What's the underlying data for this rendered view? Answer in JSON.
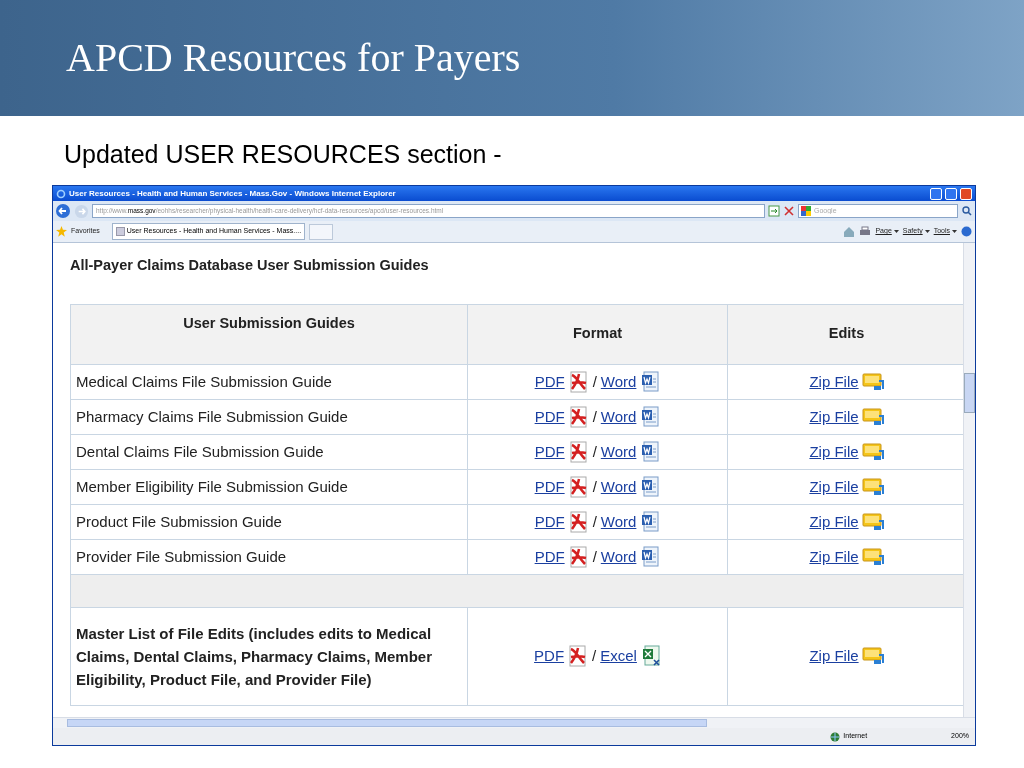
{
  "slide": {
    "title": "APCD Resources for Payers",
    "subtitle": "Updated USER RESOURCES section -"
  },
  "browser": {
    "title": "User Resources - Health and Human Services - Mass.Gov - Windows Internet Explorer",
    "url_prefix": "http://www.",
    "url_domain": "mass.gov",
    "url_path": "/eohhs/researcher/physical-health/health-care-delivery/hcf-data-resources/apcd/user-resources.html",
    "search_placeholder": "Google",
    "favorites": "Favorites",
    "tab": "User Resources - Health and Human Services - Mass....",
    "commands": [
      "Page",
      "Safety",
      "Tools"
    ],
    "status": "Internet",
    "zoom": "200%"
  },
  "page": {
    "heading": "All-Payer Claims Database User Submission Guides",
    "columns": [
      "User Submission Guides",
      "Format",
      "Edits"
    ],
    "rows": [
      {
        "kind": "guide",
        "bold": false,
        "name": "Medical Claims File Submission Guide",
        "formats": [
          {
            "label": "PDF",
            "kind": "pdf"
          },
          {
            "label": "Word",
            "kind": "word"
          }
        ],
        "separator": "/",
        "edits": "Zip File"
      },
      {
        "kind": "guide",
        "bold": false,
        "name": "Pharmacy Claims File Submission Guide",
        "formats": [
          {
            "label": "PDF",
            "kind": "pdf"
          },
          {
            "label": "Word",
            "kind": "word"
          }
        ],
        "separator": "/",
        "edits": "Zip File"
      },
      {
        "kind": "guide",
        "bold": false,
        "name": "Dental Claims File Submission Guide",
        "formats": [
          {
            "label": "PDF",
            "kind": "pdf"
          },
          {
            "label": "Word",
            "kind": "word"
          }
        ],
        "separator": "/",
        "edits": "Zip File"
      },
      {
        "kind": "guide",
        "bold": false,
        "name": "Member Eligibility File Submission Guide",
        "formats": [
          {
            "label": "PDF",
            "kind": "pdf"
          },
          {
            "label": "Word",
            "kind": "word"
          }
        ],
        "separator": "/",
        "edits": "Zip File"
      },
      {
        "kind": "guide",
        "bold": false,
        "name": "Product File Submission Guide",
        "formats": [
          {
            "label": "PDF",
            "kind": "pdf"
          },
          {
            "label": "Word",
            "kind": "word"
          }
        ],
        "separator": "/",
        "edits": "Zip File"
      },
      {
        "kind": "guide",
        "bold": false,
        "name": "Provider File Submission Guide",
        "formats": [
          {
            "label": "PDF",
            "kind": "pdf"
          },
          {
            "label": "Word",
            "kind": "word"
          }
        ],
        "separator": "/",
        "edits": "Zip File"
      },
      {
        "kind": "spacer"
      },
      {
        "kind": "guide",
        "bold": true,
        "name": "Master List of File Edits (includes edits to Medical Claims, Dental Claims, Pharmacy Claims, Member Eligibility, Product File, and Provider File)",
        "formats": [
          {
            "label": "PDF",
            "kind": "pdf"
          },
          {
            "label": "Excel",
            "kind": "excel"
          }
        ],
        "separator": "/",
        "edits": "Zip File"
      }
    ]
  }
}
